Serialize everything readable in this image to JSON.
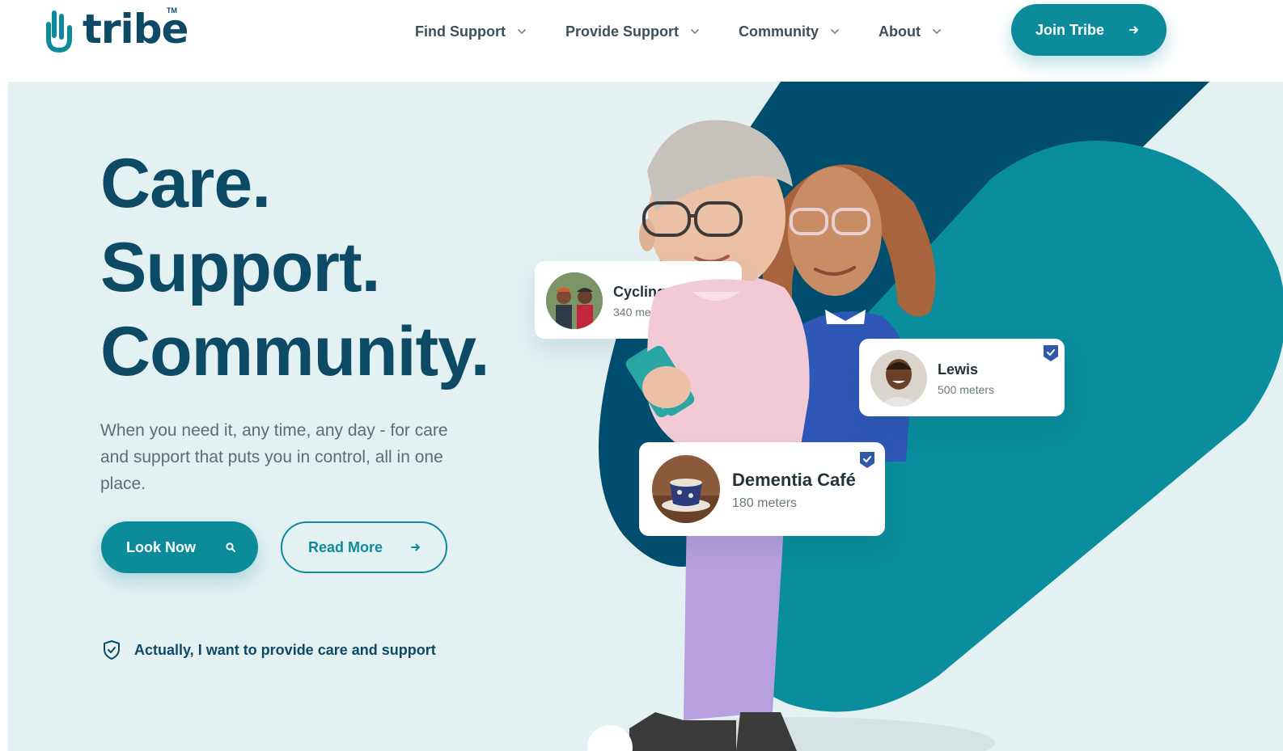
{
  "brand": {
    "name": "tribe",
    "trademark": "TM"
  },
  "nav": {
    "items": [
      {
        "label": "Find Support"
      },
      {
        "label": "Provide Support"
      },
      {
        "label": "Community"
      },
      {
        "label": "About"
      }
    ],
    "join_label": "Join Tribe"
  },
  "hero": {
    "headline": [
      "Care.",
      "Support.",
      "Community."
    ],
    "lede": "When you need it, any time, any day - for care and support that puts you in control, all in one place.",
    "look_now_label": "Look Now",
    "read_more_label": "Read More",
    "provide_link_label": "Actually, I want to provide care and support"
  },
  "cards": {
    "cycling": {
      "name": "Cycling Gro",
      "distance": "340 mete"
    },
    "lewis": {
      "name": "Lewis",
      "distance": "500 meters"
    },
    "dementia": {
      "name": "Dementia Café",
      "distance": "180 meters"
    }
  },
  "icons": {
    "logo": "tribe-hand-logo-icon",
    "nav_chevron": "chevron-down-icon",
    "join": "arrow-right-icon",
    "look_now": "search-icon",
    "read_more": "arrow-right-icon",
    "provide": "shield-check-icon",
    "verified": "verified-badge-icon"
  },
  "colors": {
    "brand_teal": "#0c8b9a",
    "navy": "#0d4a66",
    "dark_navy_shape": "#004d6e",
    "hero_bg": "#e4f1f3"
  }
}
